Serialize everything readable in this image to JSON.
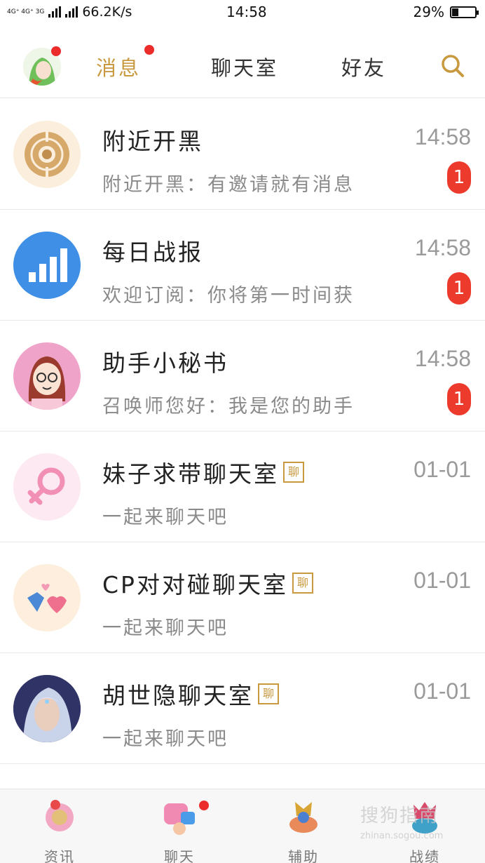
{
  "status_bar": {
    "network": "4G⁺ 4G⁺ 3G",
    "speed": "66.2K/s",
    "time": "14:58",
    "battery_percent_text": "29%",
    "battery_level": 0.29
  },
  "top_nav": {
    "tabs": [
      {
        "label": "消息",
        "active": true,
        "has_dot": true
      },
      {
        "label": "聊天室",
        "active": false,
        "has_dot": false
      },
      {
        "label": "好友",
        "active": false,
        "has_dot": false
      }
    ],
    "search_icon": "search-icon",
    "avatar_has_dot": true
  },
  "messages": [
    {
      "title": "附近开黑",
      "subtitle": "附近开黑：有邀请就有消息",
      "time": "14:58",
      "badge": "1",
      "icon": "target-icon",
      "chat_tag": ""
    },
    {
      "title": "每日战报",
      "subtitle": "欢迎订阅：你将第一时间获",
      "time": "14:58",
      "badge": "1",
      "icon": "bar-chart-icon",
      "chat_tag": ""
    },
    {
      "title": "助手小秘书",
      "subtitle": "召唤师您好：我是您的助手",
      "time": "14:58",
      "badge": "1",
      "icon": "assistant-avatar-icon",
      "chat_tag": ""
    },
    {
      "title": "妹子求带聊天室",
      "subtitle": "一起来聊天吧",
      "time": "01-01",
      "badge": "",
      "icon": "female-symbol-icon",
      "chat_tag": "聊"
    },
    {
      "title": "CP对对碰聊天室",
      "subtitle": "一起来聊天吧",
      "time": "01-01",
      "badge": "",
      "icon": "hearts-icon",
      "chat_tag": "聊"
    },
    {
      "title": "胡世隐聊天室",
      "subtitle": "一起来聊天吧",
      "time": "01-01",
      "badge": "",
      "icon": "hero-avatar-icon",
      "chat_tag": "聊"
    }
  ],
  "bottom_tabs": [
    {
      "label": "资讯",
      "active": false,
      "has_dot": false,
      "icon": "news-icon"
    },
    {
      "label": "聊天",
      "active": true,
      "has_dot": true,
      "icon": "chat-icon"
    },
    {
      "label": "辅助",
      "active": false,
      "has_dot": false,
      "icon": "assist-icon"
    },
    {
      "label": "战绩",
      "active": false,
      "has_dot": false,
      "icon": "record-icon"
    }
  ],
  "watermark": {
    "main": "搜狗指南",
    "sub": "zhinan.sogou.com"
  },
  "colors": {
    "accent": "#c8993f",
    "badge": "#ec3b2d",
    "blue": "#3f8fe6",
    "pink": "#f28fb5"
  }
}
